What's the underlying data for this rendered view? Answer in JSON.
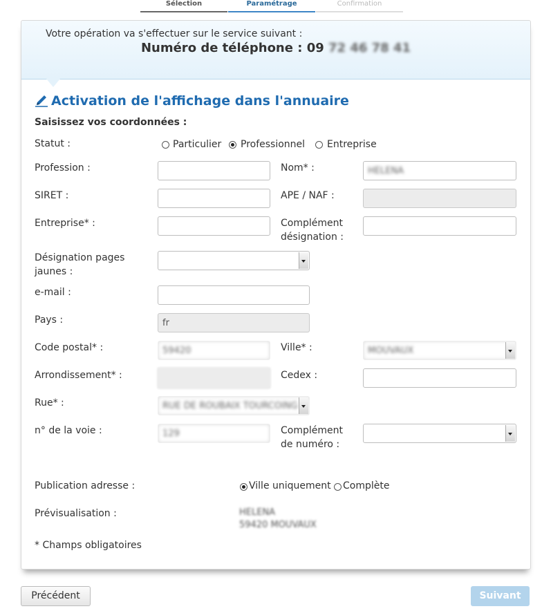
{
  "stepper": {
    "steps": [
      "Sélection",
      "Paramétrage",
      "Confirmation"
    ],
    "active_step": "Paramétrage"
  },
  "info": {
    "intro": "Votre opération va s'effectuer sur le service suivant :",
    "phone_label": "Numéro de téléphone : 09",
    "phone_hidden": "72 46 78 41"
  },
  "form": {
    "title": "Activation de l'affichage dans l'annuaire",
    "subtitle": "Saisissez vos coordonnées :",
    "statut": {
      "label": "Statut :",
      "options": [
        "Particulier",
        "Professionnel",
        "Entreprise"
      ],
      "selected": "Professionnel"
    },
    "profession": {
      "label": "Profession :",
      "value": ""
    },
    "nom": {
      "label": "Nom* :",
      "value": "HELENA"
    },
    "siret": {
      "label": "SIRET :",
      "value": ""
    },
    "ape": {
      "label": "APE / NAF :",
      "value": ""
    },
    "entreprise": {
      "label": "Entreprise* :",
      "value": ""
    },
    "complement_designation": {
      "label_1": "Complément",
      "label_2": "désignation :",
      "value": ""
    },
    "designation_pj": {
      "label_1": "Désignation pages",
      "label_2": "jaunes :",
      "value": ""
    },
    "email": {
      "label": "e-mail  :",
      "value": ""
    },
    "pays": {
      "label": "Pays :",
      "value": "fr"
    },
    "code_postal": {
      "label": "Code postal* :",
      "value": "59420"
    },
    "ville": {
      "label": "Ville* :",
      "value": "MOUVAUX"
    },
    "arrondissement": {
      "label": "Arrondissement* :",
      "value": ""
    },
    "cedex": {
      "label": "Cedex :",
      "value": ""
    },
    "rue": {
      "label": "Rue* :",
      "value": "RUE DE ROUBAIX TOURCOING"
    },
    "numero_voie": {
      "label": "n° de la voie :",
      "value": "129"
    },
    "complement_numero": {
      "label_1": "Complément",
      "label_2": "de numéro :",
      "value": ""
    },
    "publication": {
      "label": "Publication adresse :",
      "options": [
        "Ville uniquement",
        "Complète"
      ],
      "selected": "Ville uniquement"
    },
    "preview": {
      "label": "Prévisualisation :",
      "line_1": "HELENA",
      "line_2": "59420 MOUVAUX"
    },
    "required_note": "* Champs obligatoires"
  },
  "buttons": {
    "previous": "Précédent",
    "next": "Suivant"
  },
  "colors": {
    "title_blue": "#1f6bb0",
    "next_disabled": "#b3d4ec",
    "info_bg": "#e4f2fb"
  }
}
